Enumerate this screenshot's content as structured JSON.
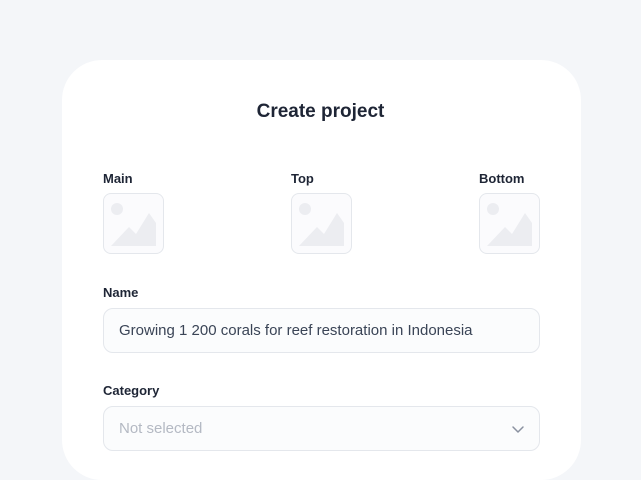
{
  "form": {
    "title": "Create project",
    "images": [
      {
        "label": "Main",
        "icon": "image-placeholder-icon"
      },
      {
        "label": "Top",
        "icon": "image-placeholder-icon"
      },
      {
        "label": "Bottom",
        "icon": "image-placeholder-icon"
      }
    ],
    "name": {
      "label": "Name",
      "value": "Growing 1 200 corals for reef restoration in Indonesia"
    },
    "category": {
      "label": "Category",
      "placeholder": "Not selected",
      "icon": "chevron-down-icon"
    }
  },
  "colors": {
    "background": "#f4f6f9",
    "card": "#ffffff",
    "text": "#1e2535",
    "border": "#e4e7ec",
    "placeholder": "#b4b9c3"
  }
}
